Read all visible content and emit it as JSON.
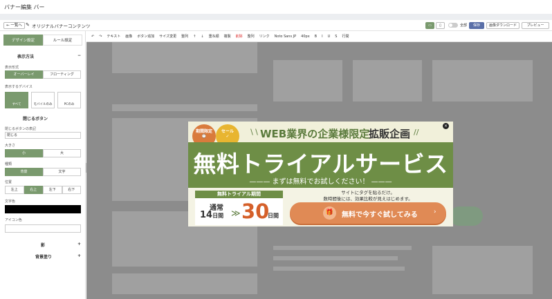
{
  "app": {
    "title": "バナー編集 バー"
  },
  "topbar": {
    "back_label": "← 一覧へ",
    "banner_name": "オリジナルバナーコンテンツ",
    "preview_toggle_label": "全部",
    "save_label": "保存",
    "download_label": "画像ダウンロード",
    "preview_label": "プレビュー"
  },
  "sidebar": {
    "tabs": [
      {
        "label": "デザイン設定"
      },
      {
        "label": "ルール設定"
      }
    ],
    "sections": {
      "display": "表示方法",
      "close_button": "閉じるボタン",
      "shadow": "影",
      "fill": "背景塗り"
    },
    "display_type_label": "表示形式",
    "display_type_options": [
      {
        "label": "オーバーレイ"
      },
      {
        "label": "フローティング"
      }
    ],
    "device_label": "表示するデバイス",
    "devices": [
      {
        "label": "すべて"
      },
      {
        "label": "モバイルのみ"
      },
      {
        "label": "PCのみ"
      }
    ],
    "close_text_label": "閉じるボタンの表記",
    "close_text_value": "閉じる",
    "size_label": "大きさ",
    "size_options": [
      {
        "label": "小"
      },
      {
        "label": "大"
      }
    ],
    "type_label": "種類",
    "type_options": [
      {
        "label": "背景"
      },
      {
        "label": "文字"
      }
    ],
    "position_label": "位置",
    "position_options": [
      {
        "label": "左上"
      },
      {
        "label": "右上"
      },
      {
        "label": "左下"
      },
      {
        "label": "右下"
      }
    ],
    "text_color_label": "文字色",
    "text_color_value": "#000000",
    "icon_color_label": "アイコン色"
  },
  "editbar": {
    "tools": [
      {
        "label": "↶"
      },
      {
        "label": "↷"
      },
      {
        "label": "テキスト"
      },
      {
        "label": "画像"
      },
      {
        "label": "ボタン追加"
      },
      {
        "label": "サイズ変更"
      },
      {
        "label": "整列"
      },
      {
        "label": "↑"
      },
      {
        "label": "↓"
      },
      {
        "label": "重ね順"
      },
      {
        "label": "複製"
      },
      {
        "label": "削除",
        "danger": true
      },
      {
        "label": "整列"
      },
      {
        "label": "リンク"
      },
      {
        "label": "Noto Sans JP"
      },
      {
        "label": "40px"
      },
      {
        "label": "B"
      },
      {
        "label": "I"
      },
      {
        "label": "U"
      },
      {
        "label": "S"
      },
      {
        "label": "行間"
      }
    ]
  },
  "banner": {
    "badge_left": "期間限定",
    "badge_right": "セール",
    "headline_green": "WEB業界の企業様限定",
    "headline_dark": "拡販企画",
    "title": "無料トライアルサービス",
    "subtitle": "——— まずは無料でお試しください！ ———",
    "period_header": "無料トライアル期間",
    "normal_label": "通常",
    "normal_days": "14",
    "normal_unit": "日間",
    "arrow": "≫",
    "trial_days": "30",
    "trial_unit": "日間",
    "note_line1": "サイトにタグを貼るだけ。",
    "note_line2": "数時間後には、効果比較が見えはじめます。",
    "cta_label": "無料で今すぐ試してみる",
    "cta_icon": "gift-icon",
    "close_icon": "×"
  },
  "colors": {
    "accent": "#7a9a6e",
    "banner_green": "#6e8e46",
    "cta": "#e08a55",
    "trial_number": "#d5602a"
  }
}
